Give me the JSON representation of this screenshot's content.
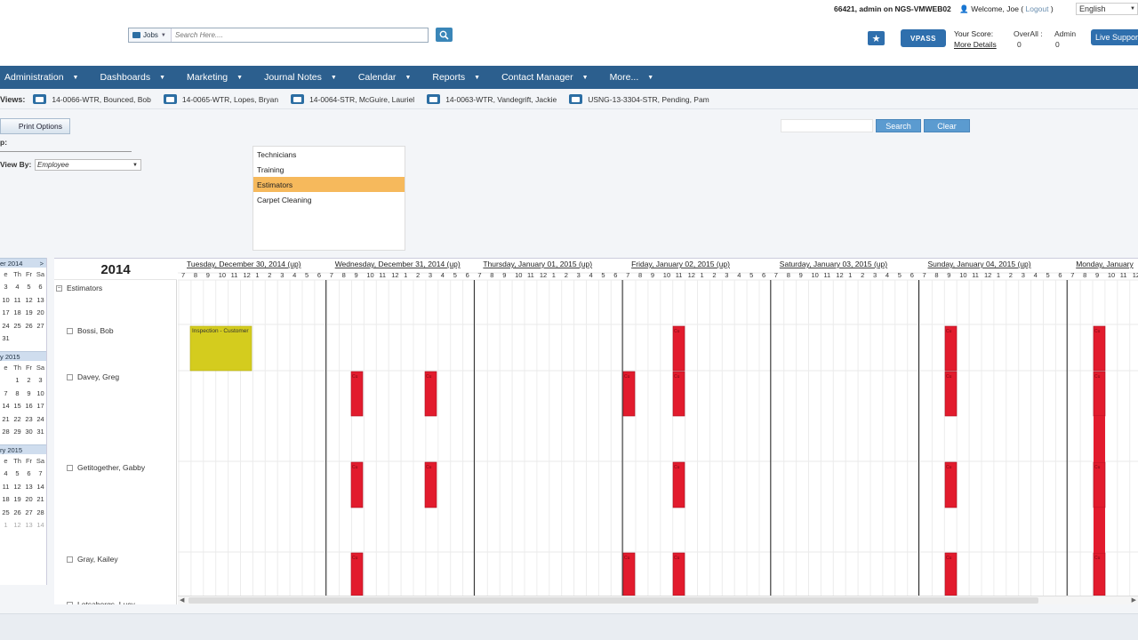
{
  "header": {
    "search_scope": "Jobs",
    "search_placeholder": "Search Here....",
    "user_line_prefix": "66421, admin on NGS-VMWEB02",
    "welcome": "Welcome, Joe",
    "logout": "Logout",
    "language": "English",
    "vpass_label": "VPASS",
    "score_label": "Your Score:",
    "more_details": "More Details",
    "overall_label": "OverAll :",
    "overall_value": "0",
    "admin_label": "Admin",
    "admin_value": "0",
    "live_support": "Live Support"
  },
  "nav": {
    "items": [
      "Administration",
      "Dashboards",
      "Marketing",
      "Journal Notes",
      "Calendar",
      "Reports",
      "Contact Manager",
      "More..."
    ]
  },
  "views": {
    "label": "Views:",
    "items": [
      "14-0066-WTR, Bounced, Bob",
      "14-0065-WTR, Lopes, Bryan",
      "14-0064-STR, McGuire, Lauriel",
      "14-0063-WTR, Vandegrift, Jackie",
      "USNG-13-3304-STR, Pending, Pam"
    ]
  },
  "controls": {
    "print_options": "Print Options",
    "group_label": "p:",
    "view_by_label": "View By:",
    "view_by_value": "Employee",
    "search_btn": "Search",
    "clear_btn": "Clear"
  },
  "groups": {
    "options": [
      "Technicians",
      "Training",
      "Estimators",
      "Carpet Cleaning"
    ],
    "selected": "Estimators"
  },
  "mini_calendars": [
    {
      "title": "er 2014",
      "dow": [
        "e",
        "Th",
        "Fr",
        "Sa"
      ],
      "rows": [
        [
          "3",
          "4",
          "5",
          "6"
        ],
        [
          "10",
          "11",
          "12",
          "13"
        ],
        [
          "17",
          "18",
          "19",
          "20"
        ],
        [
          "24",
          "25",
          "26",
          "27"
        ],
        [
          "31",
          "",
          "",
          ""
        ]
      ]
    },
    {
      "title": "y 2015",
      "dow": [
        "e",
        "Th",
        "Fr",
        "Sa"
      ],
      "rows": [
        [
          "",
          "1",
          "2",
          "3"
        ],
        [
          "7",
          "8",
          "9",
          "10"
        ],
        [
          "14",
          "15",
          "16",
          "17"
        ],
        [
          "21",
          "22",
          "23",
          "24"
        ],
        [
          "28",
          "29",
          "30",
          "31"
        ]
      ]
    },
    {
      "title": "ry 2015",
      "dow": [
        "e",
        "Th",
        "Fr",
        "Sa"
      ],
      "rows": [
        [
          "4",
          "5",
          "6",
          "7"
        ],
        [
          "11",
          "12",
          "13",
          "14"
        ],
        [
          "18",
          "19",
          "20",
          "21"
        ],
        [
          "25",
          "26",
          "27",
          "28"
        ]
      ],
      "dim_row": [
        "1",
        "12",
        "13",
        "14"
      ]
    }
  ],
  "scheduler": {
    "year": "2014",
    "group_name": "Estimators",
    "employees": [
      "Bossi, Bob",
      "Davey, Greg",
      "Getitogether, Gabby",
      "Gray, Kailey",
      "Lotsaborgs, Lucy"
    ],
    "days": [
      "Tuesday, December 30, 2014 (up)",
      "Wednesday, December 31, 2014 (up)",
      "Thursday, January 01, 2015 (up)",
      "Friday, January 02, 2015 (up)",
      "Saturday, January 03, 2015 (up)",
      "Sunday, January 04, 2015 (up)",
      "Monday, January"
    ],
    "hours": [
      "7",
      "8",
      "9",
      "10",
      "11",
      "12",
      "1",
      "2",
      "3",
      "4",
      "5",
      "6"
    ],
    "appointment_label": "Inspection - Customer",
    "event_label": "Cu"
  },
  "colors": {
    "nav_bg": "#2c5f8e",
    "selected_group": "#f6b95c",
    "inspection": "#d4cc1e",
    "event_red": "#e21b2d",
    "button_blue": "#5b9bd0"
  }
}
